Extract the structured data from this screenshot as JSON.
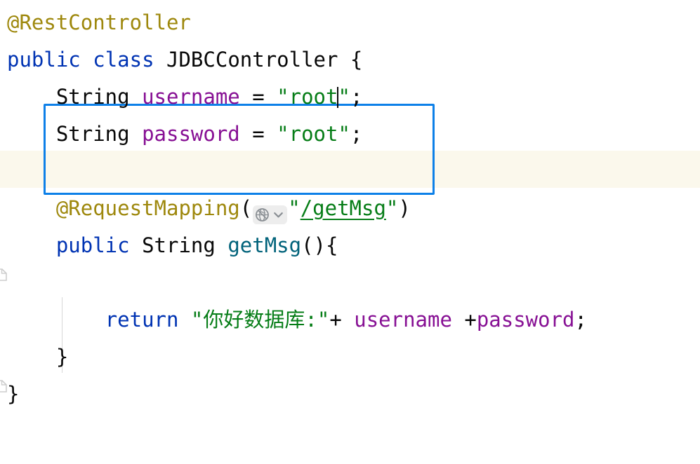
{
  "editor": {
    "language": "java",
    "theme": "IntelliJ Light",
    "colors": {
      "background": "#ffffff",
      "foreground": "#080808",
      "keyword": "#0033b3",
      "annotation": "#9e880d",
      "field": "#871094",
      "string": "#067d17",
      "method_declaration": "#00627a",
      "caret_line": "#fbf8ec",
      "highlight_box_border": "#0d80e8",
      "indent_guide": "#d7d7d7",
      "inlay_background": "#ededed"
    }
  },
  "code": {
    "lines": [
      {
        "id": "line-annotation-restcontroller",
        "text": "@RestController",
        "tokens": [
          {
            "t": "@RestController",
            "c": "ann"
          }
        ]
      },
      {
        "id": "line-class-declaration",
        "text": "public class JDBCController {",
        "tokens": [
          {
            "t": "public",
            "c": "kw"
          },
          {
            "t": " ",
            "c": "plain"
          },
          {
            "t": "class",
            "c": "kw"
          },
          {
            "t": " ",
            "c": "plain"
          },
          {
            "t": "JDBCController",
            "c": "plain"
          },
          {
            "t": " {",
            "c": "plain"
          }
        ]
      },
      {
        "id": "line-field-username",
        "text": "    String username = \"root\";",
        "tokens": [
          {
            "t": "    ",
            "c": "ind"
          },
          {
            "t": "String",
            "c": "plain"
          },
          {
            "t": " ",
            "c": "plain"
          },
          {
            "t": "username",
            "c": "field"
          },
          {
            "t": " = ",
            "c": "plain"
          },
          {
            "t": "\"root",
            "c": "str"
          },
          {
            "t": "CARET",
            "c": "caret"
          },
          {
            "t": "\"",
            "c": "str"
          },
          {
            "t": ";",
            "c": "plain"
          }
        ]
      },
      {
        "id": "line-field-password",
        "text": "    String password = \"root\";",
        "tokens": [
          {
            "t": "    ",
            "c": "ind"
          },
          {
            "t": "String",
            "c": "plain"
          },
          {
            "t": " ",
            "c": "plain"
          },
          {
            "t": "password",
            "c": "field"
          },
          {
            "t": " = ",
            "c": "plain"
          },
          {
            "t": "\"root\"",
            "c": "str"
          },
          {
            "t": ";",
            "c": "plain"
          }
        ]
      },
      {
        "id": "line-blank-1",
        "text": "",
        "tokens": []
      },
      {
        "id": "line-annotation-requestmapping",
        "text": "    @RequestMapping(\"/getMsg\")",
        "tokens": [
          {
            "t": "    ",
            "c": "ind"
          },
          {
            "t": "@RequestMapping",
            "c": "ann"
          },
          {
            "t": "(",
            "c": "plain"
          },
          {
            "t": "GLOBE_INLAY",
            "c": "inlay"
          },
          {
            "t": "\"",
            "c": "str"
          },
          {
            "t": "/getMsg",
            "c": "strlink"
          },
          {
            "t": "\"",
            "c": "str"
          },
          {
            "t": ")",
            "c": "plain"
          }
        ]
      },
      {
        "id": "line-method-getmsg",
        "text": "    public String getMsg(){",
        "tokens": [
          {
            "t": "    ",
            "c": "ind"
          },
          {
            "t": "public",
            "c": "kw"
          },
          {
            "t": " ",
            "c": "plain"
          },
          {
            "t": "String",
            "c": "plain"
          },
          {
            "t": " ",
            "c": "plain"
          },
          {
            "t": "getMsg",
            "c": "method"
          },
          {
            "t": "(){",
            "c": "plain"
          }
        ]
      },
      {
        "id": "line-blank-2",
        "text": "",
        "tokens": []
      },
      {
        "id": "line-return-statement",
        "text": "        return \"你好数据库:\"+ username +password;",
        "tokens": [
          {
            "t": "        ",
            "c": "ind"
          },
          {
            "t": "return",
            "c": "kw"
          },
          {
            "t": " ",
            "c": "plain"
          },
          {
            "t": "\"你好数据库:\"",
            "c": "str"
          },
          {
            "t": "+ ",
            "c": "plain"
          },
          {
            "t": "username",
            "c": "field"
          },
          {
            "t": " +",
            "c": "plain"
          },
          {
            "t": "password",
            "c": "field"
          },
          {
            "t": ";",
            "c": "plain"
          }
        ]
      },
      {
        "id": "line-close-method",
        "text": "    }",
        "tokens": [
          {
            "t": "    ",
            "c": "ind"
          },
          {
            "t": "}",
            "c": "plain"
          }
        ]
      },
      {
        "id": "line-close-class",
        "text": "}",
        "tokens": [
          {
            "t": "}",
            "c": "plain"
          }
        ]
      }
    ]
  },
  "widgets": {
    "globe_inlay": {
      "name": "globe-icon",
      "tooltip": "/getMsg",
      "has_chevron": true
    },
    "highlight_box": {
      "name": "field-declarations-highlight",
      "covers": "String username / String password"
    },
    "fold_markers": [
      {
        "name": "fold-marker-method",
        "state": "expanded"
      },
      {
        "name": "fold-marker-class-end",
        "state": "expanded"
      }
    ]
  }
}
